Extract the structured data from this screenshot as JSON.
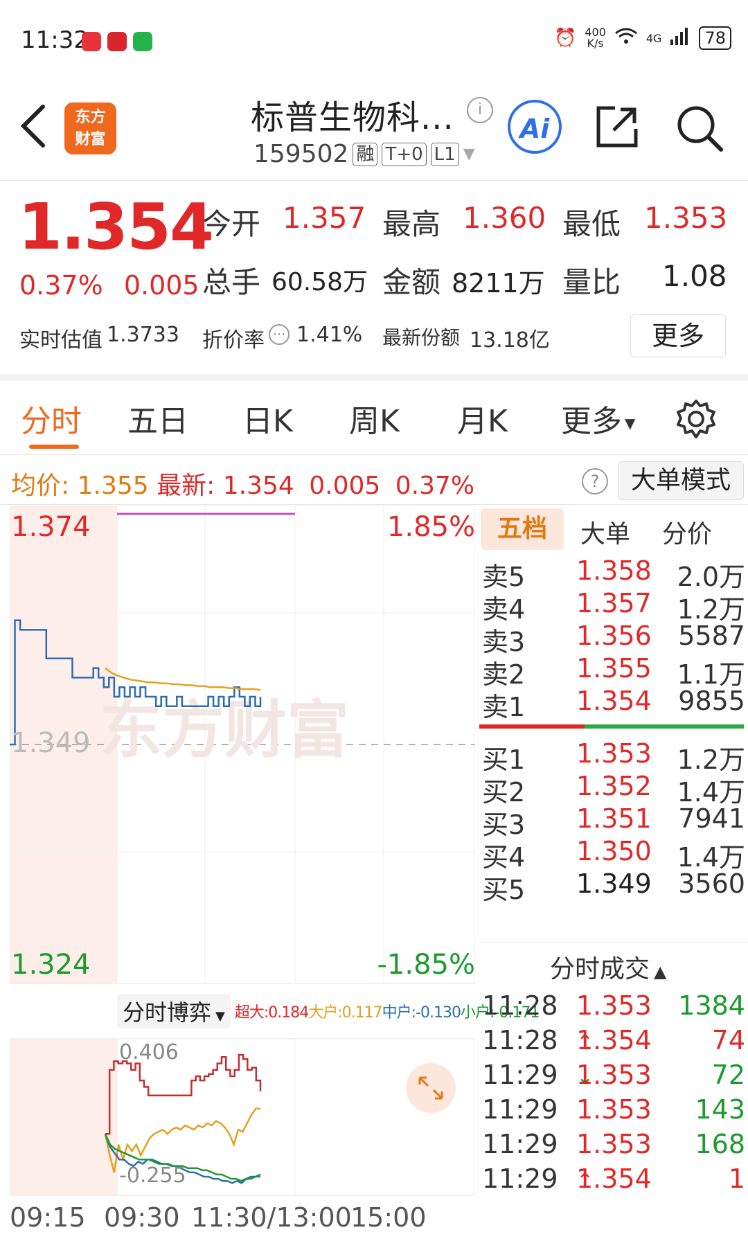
{
  "status_bar": {
    "time": "11:32",
    "net_speed_top": "400",
    "net_speed_bottom": "K/s",
    "network": "4G",
    "battery": "78"
  },
  "header": {
    "back_icon": "chevron-left-icon",
    "logo_top": "东方",
    "logo_bottom": "财富",
    "title": "标普生物科...",
    "code": "159502",
    "tags": [
      "融",
      "T+0",
      "L1"
    ],
    "ai_label": "Ai"
  },
  "quote": {
    "price": "1.354",
    "change_pct": "0.37%",
    "change_abs": "0.005",
    "open_label": "今开",
    "open": "1.357",
    "high_label": "最高",
    "high": "1.360",
    "low_label": "最低",
    "low": "1.353",
    "volume_label": "总手",
    "volume": "60.58万",
    "amount_label": "金额",
    "amount": "8211万",
    "ratio_label": "量比",
    "ratio": "1.08",
    "iopv_label": "实时估值",
    "iopv": "1.3733",
    "discount_label": "折价率",
    "discount": "1.41%",
    "shares_label": "最新份额",
    "shares": "13.18亿",
    "more_button": "更多"
  },
  "tabs": {
    "items": [
      "分时",
      "五日",
      "日K",
      "周K",
      "月K",
      "更多"
    ],
    "active": "分时"
  },
  "avg_bar": {
    "avg_label": "均价:",
    "avg_value": "1.355",
    "latest_label": "最新:",
    "latest_value": "1.354",
    "latest_change": "0.005",
    "latest_pct": "0.37%",
    "help_icon": "?",
    "big_order_mode": "大单模式"
  },
  "chart_data": {
    "type": "line",
    "title": "",
    "y_top": "1.374",
    "y_mid": "1.349",
    "y_bottom": "1.324",
    "pct_top": "1.85%",
    "pct_bottom": "-1.85%",
    "x_ticks": [
      "09:15",
      "09:30",
      "11:30/13:00",
      "15:00"
    ],
    "ylim": [
      1.324,
      1.374
    ],
    "prev_close": 1.349,
    "series": [
      {
        "color": "#2a6db5",
        "values": [
          1.349,
          1.362,
          1.361,
          1.361,
          1.361,
          1.361,
          1.361,
          1.358,
          1.358,
          1.358,
          1.358,
          1.358,
          1.356,
          1.356,
          1.356,
          1.356,
          1.357,
          1.356,
          1.355,
          1.356,
          1.354,
          1.355,
          1.354,
          1.355,
          1.354,
          1.355,
          1.354,
          1.354,
          1.353,
          1.354,
          1.353,
          1.353,
          1.354,
          1.353,
          1.353,
          1.353,
          1.353,
          1.353,
          1.354,
          1.353,
          1.354,
          1.353,
          1.354,
          1.355,
          1.354,
          1.353,
          1.354,
          1.353,
          1.354
        ]
      },
      {
        "color": "#e6a020",
        "values": [
          1.357,
          1.3565,
          1.3562,
          1.356,
          1.3558,
          1.3557,
          1.3556,
          1.3555,
          1.3555,
          1.3554,
          1.3554,
          1.3553,
          1.3553,
          1.3552,
          1.3552,
          1.3551,
          1.3551,
          1.355,
          1.355,
          1.355,
          1.3549,
          1.3549,
          1.3548,
          1.3548,
          1.3548,
          1.3547
        ]
      }
    ],
    "sub_chart": {
      "label": "分时博弈",
      "legend": [
        {
          "text": "超大:0.184",
          "color": "#e02828"
        },
        {
          "text": "大户:0.117",
          "color": "#e6a020"
        },
        {
          "text": "中户:-0.130",
          "color": "#2a6db5"
        },
        {
          "text": "小户:-0.171",
          "color": "#1b9a2e"
        }
      ],
      "y_top": "0.406",
      "y_bottom": "-0.255",
      "ylim": [
        -0.255,
        0.406
      ],
      "series": [
        {
          "color": "#c03030",
          "values": [
            0.0,
            0.3,
            0.34,
            0.33,
            0.34,
            0.33,
            0.3,
            0.33,
            0.25,
            0.22,
            0.18,
            0.18,
            0.18,
            0.18,
            0.18,
            0.18,
            0.18,
            0.18,
            0.18,
            0.18,
            0.25,
            0.27,
            0.25,
            0.27,
            0.28,
            0.3,
            0.33,
            0.36,
            0.3,
            0.27,
            0.3,
            0.37,
            0.35,
            0.3,
            0.31,
            0.25,
            0.2
          ]
        },
        {
          "color": "#e6a020",
          "values": [
            0.0,
            -0.1,
            -0.18,
            -0.05,
            -0.12,
            -0.05,
            -0.08,
            -0.05,
            -0.1,
            -0.06,
            -0.02,
            0.0,
            0.01,
            0.02,
            0.0,
            0.02,
            0.03,
            0.02,
            0.04,
            0.03,
            0.02,
            0.04,
            0.03,
            0.05,
            0.04,
            0.06,
            0.05,
            0.03,
            0.0,
            -0.05,
            0.02,
            0.01,
            0.05,
            0.09,
            0.12,
            0.117
          ]
        },
        {
          "color": "#2a6db5",
          "values": [
            0.0,
            -0.06,
            -0.09,
            -0.12,
            -0.12,
            -0.14,
            -0.15,
            -0.13,
            -0.14,
            -0.12,
            -0.12,
            -0.13,
            -0.14,
            -0.14,
            -0.15,
            -0.15,
            -0.16,
            -0.17,
            -0.18,
            -0.18,
            -0.19,
            -0.2,
            -0.2,
            -0.21,
            -0.21,
            -0.22,
            -0.22,
            -0.23,
            -0.22,
            -0.23,
            -0.21,
            -0.2,
            -0.2,
            -0.19
          ]
        },
        {
          "color": "#1b9a2e",
          "values": [
            0.0,
            -0.05,
            -0.07,
            -0.08,
            -0.09,
            -0.1,
            -0.11,
            -0.12,
            -0.12,
            -0.12,
            -0.13,
            -0.14,
            -0.14,
            -0.14,
            -0.15,
            -0.15,
            -0.15,
            -0.16,
            -0.16,
            -0.16,
            -0.17,
            -0.17,
            -0.18,
            -0.19,
            -0.19,
            -0.2,
            -0.21,
            -0.21,
            -0.22,
            -0.21,
            -0.21,
            -0.2,
            -0.2
          ]
        }
      ]
    }
  },
  "order_book": {
    "tabs": [
      "五档",
      "大单",
      "分价"
    ],
    "asks": [
      {
        "label": "卖5",
        "price": "1.358",
        "vol": "2.0万"
      },
      {
        "label": "卖4",
        "price": "1.357",
        "vol": "1.2万"
      },
      {
        "label": "卖3",
        "price": "1.356",
        "vol": "5587"
      },
      {
        "label": "卖2",
        "price": "1.355",
        "vol": "1.1万"
      },
      {
        "label": "卖1",
        "price": "1.354",
        "vol": "9855"
      }
    ],
    "bids": [
      {
        "label": "买1",
        "price": "1.353",
        "vol": "1.2万"
      },
      {
        "label": "买2",
        "price": "1.352",
        "vol": "1.4万"
      },
      {
        "label": "买3",
        "price": "1.351",
        "vol": "7941"
      },
      {
        "label": "买4",
        "price": "1.350",
        "vol": "1.4万"
      },
      {
        "label": "买5",
        "price": "1.349",
        "vol": "3560"
      }
    ],
    "trades_header": "分时成交",
    "trades": [
      {
        "time": "11:28",
        "price": "1.353",
        "arrow": "",
        "vol": "1384",
        "dir": "down"
      },
      {
        "time": "11:28",
        "price": "1.354",
        "arrow": "↑",
        "vol": "74",
        "dir": "up"
      },
      {
        "time": "11:29",
        "price": "1.353",
        "arrow": "↓",
        "vol": "72",
        "dir": "down"
      },
      {
        "time": "11:29",
        "price": "1.353",
        "arrow": "",
        "vol": "143",
        "dir": "down"
      },
      {
        "time": "11:29",
        "price": "1.353",
        "arrow": "",
        "vol": "168",
        "dir": "down"
      },
      {
        "time": "11:29",
        "price": "1.354",
        "arrow": "↑",
        "vol": "1",
        "dir": "up"
      }
    ]
  },
  "colors": {
    "up": "#e02828",
    "down": "#1b9a2e",
    "brand": "#f0681e",
    "price_line": "#2a6db5",
    "avg_line": "#e6a020"
  }
}
